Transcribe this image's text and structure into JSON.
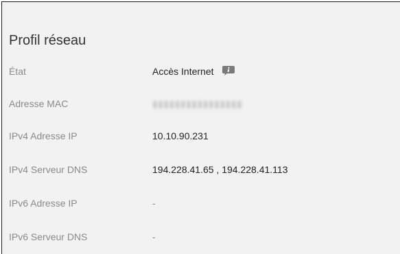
{
  "section": {
    "title": "Profil réseau"
  },
  "rows": [
    {
      "label": "État",
      "value": "Accès Internet",
      "icon": "info-icon"
    },
    {
      "label": "Adresse MAC",
      "value": "",
      "note": "value blurred"
    },
    {
      "label": "IPv4 Adresse IP",
      "value": "10.10.90.231"
    },
    {
      "label": "IPv4 Serveur DNS",
      "value": "194.228.41.65 , 194.228.41.113"
    },
    {
      "label": "IPv6 Adresse IP",
      "value": "-"
    },
    {
      "label": "IPv6 Serveur DNS",
      "value": "-"
    }
  ],
  "colors": {
    "background": "#f2f2f2",
    "label": "#8a8a8a",
    "value": "#222222",
    "title": "#333333",
    "icon": "#7a7a7a"
  }
}
